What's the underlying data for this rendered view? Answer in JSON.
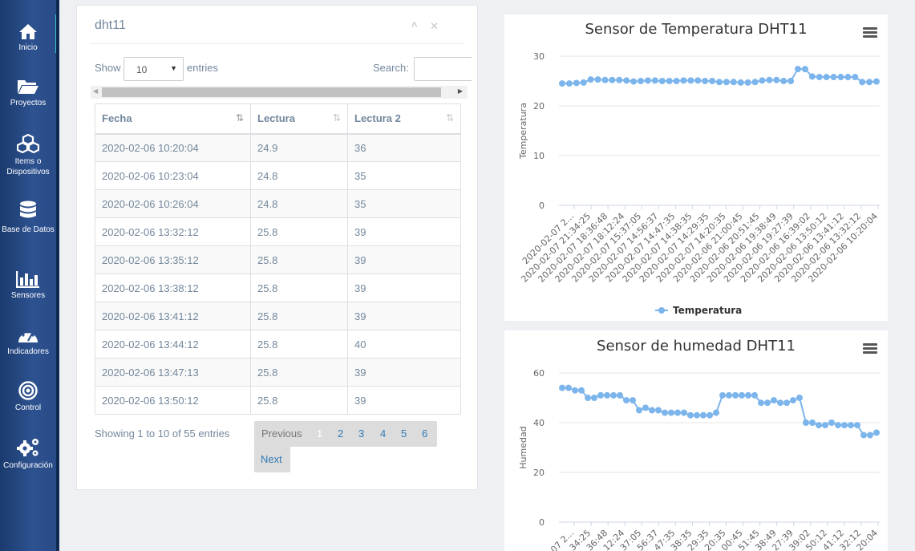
{
  "sidebar": {
    "items": [
      {
        "label": "Inicio",
        "icon": "home-icon"
      },
      {
        "label": "Proyectos",
        "icon": "folder-icon"
      },
      {
        "label": "Items o Dispositivos",
        "icon": "cubes-icon"
      },
      {
        "label": "Base de Datos",
        "icon": "database-icon"
      },
      {
        "label": "Sensores",
        "icon": "bar-chart-icon"
      },
      {
        "label": "Indicadores",
        "icon": "gauge-icon"
      },
      {
        "label": "Control",
        "icon": "target-icon"
      },
      {
        "label": "Configuración",
        "icon": "gears-icon"
      }
    ]
  },
  "panel": {
    "title": "dht11",
    "collapse_glyph": "^",
    "close_glyph": "✕",
    "show_label": "Show",
    "entries_value": "10",
    "entries_label": "entries",
    "search_label": "Search:",
    "columns": [
      "Fecha",
      "Lectura",
      "Lectura 2"
    ],
    "rows": [
      [
        "2020-02-06 10:20:04",
        "24.9",
        "36"
      ],
      [
        "2020-02-06 10:23:04",
        "24.8",
        "35"
      ],
      [
        "2020-02-06 10:26:04",
        "24.8",
        "35"
      ],
      [
        "2020-02-06 13:32:12",
        "25.8",
        "39"
      ],
      [
        "2020-02-06 13:35:12",
        "25.8",
        "39"
      ],
      [
        "2020-02-06 13:38:12",
        "25.8",
        "39"
      ],
      [
        "2020-02-06 13:41:12",
        "25.8",
        "39"
      ],
      [
        "2020-02-06 13:44:12",
        "25.8",
        "40"
      ],
      [
        "2020-02-06 13:47:13",
        "25.8",
        "39"
      ],
      [
        "2020-02-06 13:50:12",
        "25.8",
        "39"
      ]
    ],
    "info": "Showing 1 to 10 of 55 entries",
    "previous_label": "Previous",
    "next_label": "Next",
    "pages": [
      "1",
      "2",
      "3",
      "4",
      "5",
      "6"
    ]
  },
  "colors": {
    "series": "#7cb5ec",
    "accent": "#3ac4c9",
    "link": "#337ab7"
  },
  "chart_data": [
    {
      "type": "line",
      "title": "Sensor de Temperatura DHT11",
      "ylabel": "Temperatura",
      "ylim": [
        0,
        30
      ],
      "yticks": [
        0,
        10,
        20,
        30
      ],
      "legend": "Temperatura",
      "legend_position": "bottom",
      "x_tick_labels": [
        "2020-02-07 2...",
        "2020-02-07 21:34:25",
        "2020-02-07 18:36:48",
        "2020-02-07 18:12:24",
        "2020-02-07 15:37:05",
        "2020-02-07 14:56:37",
        "2020-02-07 14:47:35",
        "2020-02-07 14:38:35",
        "2020-02-07 14:29:35",
        "2020-02-07 14:20:35",
        "2020-02-06 21:00:45",
        "2020-02-06 20:51:45",
        "2020-02-06 19:38:49",
        "2020-02-06 19:27:39",
        "2020-02-06 16:39:02",
        "2020-02-06 13:50:12",
        "2020-02-06 13:41:12",
        "2020-02-06 13:32:12",
        "2020-02-06 10:20:04"
      ],
      "series": [
        {
          "name": "Temperatura",
          "values": [
            24.5,
            24.5,
            24.6,
            24.7,
            25.3,
            25.3,
            25.2,
            25.2,
            25.2,
            25.1,
            24.9,
            25.0,
            25.1,
            25.1,
            25.0,
            25.0,
            25.0,
            25.1,
            25.1,
            25.1,
            25.0,
            25.0,
            24.8,
            24.8,
            24.8,
            24.7,
            24.7,
            24.8,
            25.1,
            25.2,
            25.2,
            25.0,
            25.0,
            27.4,
            27.4,
            25.9,
            25.8,
            25.8,
            25.8,
            25.8,
            25.8,
            25.8,
            24.8,
            24.8,
            24.9
          ]
        }
      ]
    },
    {
      "type": "line",
      "title": "Sensor de humedad DHT11",
      "ylabel": "Humedad",
      "ylim": [
        0,
        60
      ],
      "yticks": [
        0,
        20,
        40,
        60
      ],
      "x_tick_labels": [
        "07 2...",
        "34:25",
        "36:48",
        "12:24",
        "37:05",
        "56:37",
        "47:35",
        "38:35",
        "29:35",
        "20:35",
        "00:45",
        "51:45",
        "38:49",
        "27:39",
        "39:02",
        "50:12",
        "41:12",
        "32:12",
        "20:04"
      ],
      "series": [
        {
          "name": "Humedad",
          "values": [
            54,
            54,
            53,
            53,
            50,
            50,
            51,
            51,
            51,
            51,
            49,
            49,
            45,
            46,
            45,
            45,
            44,
            44,
            44,
            44,
            43,
            43,
            43,
            43,
            44,
            51,
            51,
            51,
            51,
            51,
            51,
            48,
            48,
            49,
            48,
            48,
            49,
            50,
            40,
            40,
            39,
            39,
            40,
            39,
            39,
            39,
            39,
            35,
            35,
            36
          ]
        }
      ]
    }
  ]
}
